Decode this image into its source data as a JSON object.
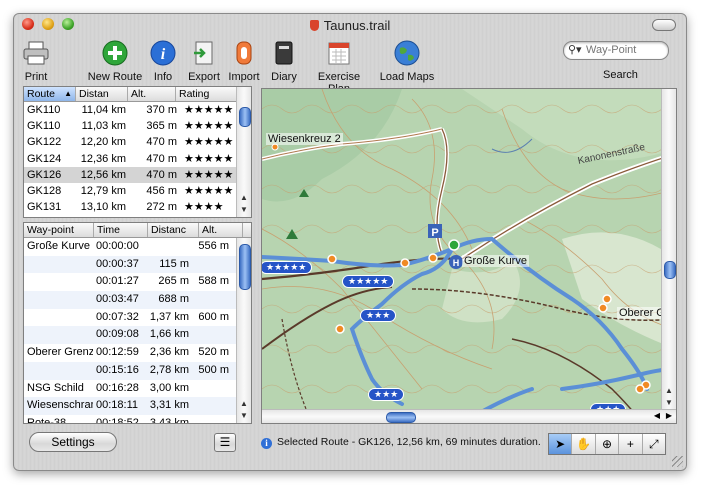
{
  "window": {
    "title": "Taunus.trail"
  },
  "toolbar": {
    "items": [
      {
        "label": "Print",
        "icon": "printer-icon"
      },
      {
        "label": "New Route",
        "icon": "plus-circle-icon"
      },
      {
        "label": "Info",
        "icon": "info-icon"
      },
      {
        "label": "Export",
        "icon": "export-icon"
      },
      {
        "label": "Import",
        "icon": "import-icon"
      },
      {
        "label": "Diary",
        "icon": "diary-icon"
      },
      {
        "label": "Exercise Plan",
        "icon": "calendar-icon"
      },
      {
        "label": "Load Maps",
        "icon": "globe-icon"
      }
    ],
    "search_placeholder": "Way-Point",
    "search_label": "Search"
  },
  "routes": {
    "columns": [
      "Route",
      "Distan",
      "Alt.",
      "Rating"
    ],
    "rows": [
      [
        "GK110",
        "11,04 km",
        "370 m",
        "★★★★★"
      ],
      [
        "GK110",
        "11,03 km",
        "365 m",
        "★★★★★"
      ],
      [
        "GK122",
        "12,20 km",
        "470 m",
        "★★★★★"
      ],
      [
        "GK124",
        "12,36 km",
        "470 m",
        "★★★★★"
      ],
      [
        "GK126",
        "12,56 km",
        "470 m",
        "★★★★★"
      ],
      [
        "GK128",
        "12,79 km",
        "456 m",
        "★★★★★"
      ],
      [
        "GK131",
        "13,10 km",
        "272 m",
        "★★★★"
      ]
    ]
  },
  "waypoints": {
    "columns": [
      "Way-point",
      "Time",
      "Distanc",
      "Alt."
    ],
    "rows": [
      [
        "Große Kurve",
        "00:00:00",
        "",
        "556 m"
      ],
      [
        "",
        "00:00:37",
        "115 m",
        ""
      ],
      [
        "",
        "00:01:27",
        "265 m",
        "588 m"
      ],
      [
        "",
        "00:03:47",
        "688 m",
        ""
      ],
      [
        "",
        "00:07:32",
        "1,37 km",
        "600 m"
      ],
      [
        "",
        "00:09:08",
        "1,66 km",
        ""
      ],
      [
        "Oberer Grenzw",
        "00:12:59",
        "2,36 km",
        "520 m"
      ],
      [
        "",
        "00:15:16",
        "2,78 km",
        "500 m"
      ],
      [
        "NSG Schild",
        "00:16:28",
        "3,00 km",
        ""
      ],
      [
        "Wiesenschran",
        "00:18:11",
        "3,31 km",
        ""
      ],
      [
        "Rote-38",
        "00:18:52",
        "3,43 km",
        ""
      ]
    ]
  },
  "map": {
    "labels": [
      "Wiesenkreuz 2",
      "Kanonenstraße",
      "Große Kurve",
      "Oberer G"
    ],
    "rating_badges": [
      "★★★★★",
      "★★★★★",
      "★★★",
      "★★★",
      "★★★"
    ]
  },
  "bottom": {
    "settings_label": "Settings",
    "status_text": "Selected Route - GK126, 12,56 km, 69 minutes duration.",
    "tools": [
      "arrow-tool-icon",
      "hand-tool-icon",
      "zoom-tool-icon",
      "crosshair-tool-icon",
      "measure-tool-icon"
    ]
  },
  "colors": {
    "route_blue": "#5b8fd6",
    "badge_blue": "#2554c7",
    "waypoint_orange": "#f08a24",
    "selected_row": "#d4d4d4"
  }
}
